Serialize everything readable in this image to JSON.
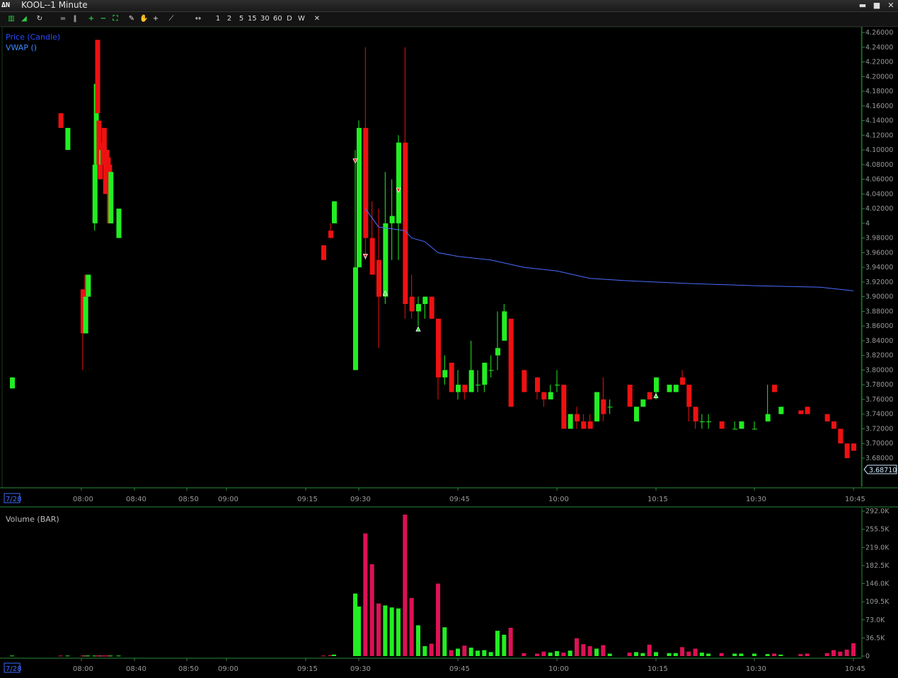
{
  "window": {
    "logo": "ΔΝ",
    "title": "KOOL--1 Minute",
    "controls": {
      "minimize": "▬",
      "maximize": "■",
      "close": "✕"
    }
  },
  "toolbar": {
    "icons": [
      "bar-chart-icon",
      "line-chart-icon",
      "refresh-icon",
      "equals-icon",
      "pause-icon",
      "zoom-in-icon",
      "zoom-out-icon",
      "fit-icon",
      "pencil-icon",
      "hand-icon",
      "crosshair-icon",
      "line-tool-icon",
      "horizontal-scroll-icon"
    ],
    "timeframes": [
      "1",
      "2",
      "5",
      "15",
      "30",
      "60",
      "D",
      "W"
    ],
    "close_label": "✕"
  },
  "price_panel": {
    "legend_price": "Price (Candle)",
    "legend_vwap": "VWAP ()",
    "last_price": "3.68710",
    "axis_ticks": [
      "4.26000",
      "4.24000",
      "4.22000",
      "4.20000",
      "4.18000",
      "4.16000",
      "4.14000",
      "4.12000",
      "4.10000",
      "4.08000",
      "4.06000",
      "4.04000",
      "4.02000",
      "4",
      "3.98000",
      "3.96000",
      "3.94000",
      "3.92000",
      "3.90000",
      "3.88000",
      "3.86000",
      "3.84000",
      "3.82000",
      "3.80000",
      "3.78000",
      "3.76000",
      "3.74000",
      "3.72000",
      "3.70000",
      "3.68000"
    ],
    "date_label": "7/28",
    "time_labels": [
      "08:00",
      "08:40",
      "08:50",
      "09:00",
      "09:15",
      "09:30",
      "09:45",
      "10:00",
      "10:15",
      "10:30",
      "10:45"
    ]
  },
  "volume_panel": {
    "legend": "Volume (BAR)",
    "axis_ticks": [
      "292.0K",
      "255.5K",
      "219.0K",
      "182.5K",
      "146.0K",
      "109.5K",
      "73.0K",
      "36.5K",
      "0"
    ],
    "date_label": "7/28",
    "time_labels": [
      "08:00",
      "08:40",
      "08:50",
      "09:00",
      "09:15",
      "09:30",
      "09:45",
      "10:00",
      "10:15",
      "10:30",
      "10:45"
    ]
  },
  "colors": {
    "up": "#22ee22",
    "down": "#ee1111",
    "vwap": "#4a6cff",
    "volume_up": "#22ee22",
    "volume_down": "#dd1155",
    "grid_green": "#1e6b2a",
    "legend_blue": "#2a4dff"
  },
  "chart_data": {
    "type": "candlestick",
    "symbol": "KOOL",
    "interval": "1 Minute",
    "ylim": [
      3.68,
      4.26
    ],
    "volume_ylim": [
      0,
      292000
    ],
    "candles": [
      {
        "t": "07:40",
        "o": 3.775,
        "h": 3.79,
        "l": 3.775,
        "c": 3.79,
        "v": 1000
      },
      {
        "t": "07:54",
        "o": 4.15,
        "h": 4.15,
        "l": 4.13,
        "c": 4.13,
        "v": 1000
      },
      {
        "t": "07:56",
        "o": 4.1,
        "h": 4.13,
        "l": 4.1,
        "c": 4.13,
        "v": 1000
      },
      {
        "t": "08:01",
        "o": 3.91,
        "h": 3.91,
        "l": 3.8,
        "c": 3.85,
        "v": 1000
      },
      {
        "t": "08:02",
        "o": 3.9,
        "h": 3.9,
        "l": 3.85,
        "c": 3.85,
        "v": 1000
      },
      {
        "t": "08:03",
        "o": 3.85,
        "h": 3.9,
        "l": 3.85,
        "c": 3.9,
        "v": 1000
      },
      {
        "t": "08:04",
        "o": 3.93,
        "h": 3.93,
        "l": 3.9,
        "c": 3.9,
        "v": 1000
      },
      {
        "t": "08:05",
        "o": 3.9,
        "h": 3.93,
        "l": 3.9,
        "c": 3.93,
        "v": 1000
      },
      {
        "t": "08:10",
        "o": 4.0,
        "h": 4.08,
        "l": 3.99,
        "c": 4.08,
        "v": 1000
      },
      {
        "t": "08:11",
        "o": 4.08,
        "h": 4.19,
        "l": 4.08,
        "c": 4.19,
        "v": 1000
      },
      {
        "t": "08:12",
        "o": 4.25,
        "h": 4.25,
        "l": 4.15,
        "c": 4.15,
        "v": 1000
      },
      {
        "t": "08:13",
        "o": 4.14,
        "h": 4.14,
        "l": 4.08,
        "c": 4.08,
        "v": 1000
      },
      {
        "t": "08:14",
        "o": 4.08,
        "h": 4.08,
        "l": 4.06,
        "c": 4.06,
        "v": 1000
      },
      {
        "t": "08:15",
        "o": 4.08,
        "h": 4.1,
        "l": 4.08,
        "c": 4.1,
        "v": 1000
      },
      {
        "t": "08:16",
        "o": 4.11,
        "h": 4.11,
        "l": 4.08,
        "c": 4.08,
        "v": 1000
      },
      {
        "t": "08:17",
        "o": 4.13,
        "h": 4.13,
        "l": 4.08,
        "c": 4.08,
        "v": 1000
      },
      {
        "t": "08:18",
        "o": 4.1,
        "h": 4.1,
        "l": 4.04,
        "c": 4.04,
        "v": 1000
      },
      {
        "t": "08:19",
        "o": 4.1,
        "h": 4.1,
        "l": 4.09,
        "c": 4.09,
        "v": 1000
      },
      {
        "t": "08:20",
        "o": 4.09,
        "h": 4.09,
        "l": 4.08,
        "c": 4.08,
        "v": 1000
      },
      {
        "t": "08:21",
        "o": 4.08,
        "h": 4.08,
        "l": 4.0,
        "c": 4.0,
        "v": 1000
      },
      {
        "t": "08:22",
        "o": 4.0,
        "h": 4.07,
        "l": 4.0,
        "c": 4.07,
        "v": 1000
      },
      {
        "t": "08:28",
        "o": 3.98,
        "h": 4.02,
        "l": 3.98,
        "c": 4.02,
        "v": 1000
      },
      {
        "t": "09:20",
        "o": 3.97,
        "h": 3.97,
        "l": 3.95,
        "c": 3.95,
        "v": 1000
      },
      {
        "t": "09:22",
        "o": 3.99,
        "h": 4.0,
        "l": 3.98,
        "c": 3.98,
        "v": 2000
      },
      {
        "t": "09:23",
        "o": 4.0,
        "h": 4.03,
        "l": 4.0,
        "c": 4.03,
        "v": 3000
      },
      {
        "t": "09:29",
        "o": 3.8,
        "h": 4.1,
        "l": 3.8,
        "c": 3.94,
        "v": 126000
      },
      {
        "t": "09:30",
        "o": 3.94,
        "h": 4.14,
        "l": 3.94,
        "c": 4.13,
        "v": 100000
      },
      {
        "t": "09:31",
        "o": 4.13,
        "h": 4.24,
        "l": 3.95,
        "c": 3.98,
        "v": 247000
      },
      {
        "t": "09:32",
        "o": 3.98,
        "h": 4.03,
        "l": 3.93,
        "c": 3.93,
        "v": 185000
      },
      {
        "t": "09:33",
        "o": 3.95,
        "h": 4.02,
        "l": 3.83,
        "c": 3.9,
        "v": 106000
      },
      {
        "t": "09:34",
        "o": 3.9,
        "h": 4.07,
        "l": 3.89,
        "c": 4.0,
        "v": 102000
      },
      {
        "t": "09:35",
        "o": 4.0,
        "h": 4.06,
        "l": 3.95,
        "c": 4.01,
        "v": 98000
      },
      {
        "t": "09:36",
        "o": 4.0,
        "h": 4.12,
        "l": 3.95,
        "c": 4.11,
        "v": 96000
      },
      {
        "t": "09:37",
        "o": 4.11,
        "h": 4.24,
        "l": 3.87,
        "c": 3.89,
        "v": 285000
      },
      {
        "t": "09:38",
        "o": 3.9,
        "h": 3.93,
        "l": 3.87,
        "c": 3.88,
        "v": 117000
      },
      {
        "t": "09:39",
        "o": 3.88,
        "h": 3.9,
        "l": 3.86,
        "c": 3.89,
        "v": 62000
      },
      {
        "t": "09:40",
        "o": 3.89,
        "h": 3.9,
        "l": 3.87,
        "c": 3.9,
        "v": 20000
      },
      {
        "t": "09:41",
        "o": 3.9,
        "h": 3.9,
        "l": 3.87,
        "c": 3.87,
        "v": 25000
      },
      {
        "t": "09:42",
        "o": 3.87,
        "h": 3.87,
        "l": 3.76,
        "c": 3.79,
        "v": 146000
      },
      {
        "t": "09:43",
        "o": 3.79,
        "h": 3.82,
        "l": 3.78,
        "c": 3.8,
        "v": 58000
      },
      {
        "t": "09:44",
        "o": 3.81,
        "h": 3.81,
        "l": 3.77,
        "c": 3.77,
        "v": 12000
      },
      {
        "t": "09:45",
        "o": 3.77,
        "h": 3.8,
        "l": 3.76,
        "c": 3.78,
        "v": 15000
      },
      {
        "t": "09:46",
        "o": 3.78,
        "h": 3.78,
        "l": 3.76,
        "c": 3.77,
        "v": 21000
      },
      {
        "t": "09:47",
        "o": 3.77,
        "h": 3.84,
        "l": 3.77,
        "c": 3.8,
        "v": 17000
      },
      {
        "t": "09:48",
        "o": 3.78,
        "h": 3.8,
        "l": 3.77,
        "c": 3.78,
        "v": 11000
      },
      {
        "t": "09:49",
        "o": 3.78,
        "h": 3.81,
        "l": 3.77,
        "c": 3.81,
        "v": 12000
      },
      {
        "t": "09:50",
        "o": 3.8,
        "h": 3.82,
        "l": 3.79,
        "c": 3.8,
        "v": 8000
      },
      {
        "t": "09:51",
        "o": 3.82,
        "h": 3.88,
        "l": 3.8,
        "c": 3.83,
        "v": 51000
      },
      {
        "t": "09:52",
        "o": 3.84,
        "h": 3.89,
        "l": 3.84,
        "c": 3.88,
        "v": 43000
      },
      {
        "t": "09:53",
        "o": 3.87,
        "h": 3.87,
        "l": 3.75,
        "c": 3.75,
        "v": 57000
      },
      {
        "t": "09:55",
        "o": 3.8,
        "h": 3.8,
        "l": 3.77,
        "c": 3.77,
        "v": 6000
      },
      {
        "t": "09:57",
        "o": 3.79,
        "h": 3.79,
        "l": 3.76,
        "c": 3.77,
        "v": 5000
      },
      {
        "t": "09:58",
        "o": 3.77,
        "h": 3.77,
        "l": 3.75,
        "c": 3.76,
        "v": 9000
      },
      {
        "t": "09:59",
        "o": 3.76,
        "h": 3.78,
        "l": 3.76,
        "c": 3.77,
        "v": 7000
      },
      {
        "t": "10:00",
        "o": 3.78,
        "h": 3.8,
        "l": 3.77,
        "c": 3.78,
        "v": 10000
      },
      {
        "t": "10:01",
        "o": 3.78,
        "h": 3.78,
        "l": 3.72,
        "c": 3.72,
        "v": 7000
      },
      {
        "t": "10:02",
        "o": 3.72,
        "h": 3.74,
        "l": 3.72,
        "c": 3.74,
        "v": 11000
      },
      {
        "t": "10:03",
        "o": 3.74,
        "h": 3.75,
        "l": 3.72,
        "c": 3.73,
        "v": 36000
      },
      {
        "t": "10:04",
        "o": 3.73,
        "h": 3.74,
        "l": 3.72,
        "c": 3.72,
        "v": 24000
      },
      {
        "t": "10:05",
        "o": 3.73,
        "h": 3.74,
        "l": 3.72,
        "c": 3.72,
        "v": 20000
      },
      {
        "t": "10:06",
        "o": 3.73,
        "h": 3.77,
        "l": 3.73,
        "c": 3.77,
        "v": 15000
      },
      {
        "t": "10:07",
        "o": 3.76,
        "h": 3.79,
        "l": 3.73,
        "c": 3.74,
        "v": 22000
      },
      {
        "t": "10:08",
        "o": 3.75,
        "h": 3.76,
        "l": 3.74,
        "c": 3.75,
        "v": 5000
      },
      {
        "t": "10:11",
        "o": 3.78,
        "h": 3.78,
        "l": 3.75,
        "c": 3.75,
        "v": 7000
      },
      {
        "t": "10:12",
        "o": 3.73,
        "h": 3.75,
        "l": 3.73,
        "c": 3.75,
        "v": 8000
      },
      {
        "t": "10:13",
        "o": 3.75,
        "h": 3.76,
        "l": 3.75,
        "c": 3.76,
        "v": 6000
      },
      {
        "t": "10:14",
        "o": 3.77,
        "h": 3.77,
        "l": 3.76,
        "c": 3.76,
        "v": 23000
      },
      {
        "t": "10:15",
        "o": 3.77,
        "h": 3.79,
        "l": 3.76,
        "c": 3.79,
        "v": 8000
      },
      {
        "t": "10:17",
        "o": 3.77,
        "h": 3.78,
        "l": 3.77,
        "c": 3.78,
        "v": 6000
      },
      {
        "t": "10:18",
        "o": 3.77,
        "h": 3.78,
        "l": 3.77,
        "c": 3.78,
        "v": 6000
      },
      {
        "t": "10:19",
        "o": 3.79,
        "h": 3.8,
        "l": 3.78,
        "c": 3.78,
        "v": 18000
      },
      {
        "t": "10:20",
        "o": 3.78,
        "h": 3.78,
        "l": 3.73,
        "c": 3.75,
        "v": 9000
      },
      {
        "t": "10:21",
        "o": 3.75,
        "h": 3.75,
        "l": 3.72,
        "c": 3.73,
        "v": 15000
      },
      {
        "t": "10:22",
        "o": 3.73,
        "h": 3.74,
        "l": 3.72,
        "c": 3.73,
        "v": 7000
      },
      {
        "t": "10:23",
        "o": 3.73,
        "h": 3.74,
        "l": 3.72,
        "c": 3.73,
        "v": 5000
      },
      {
        "t": "10:25",
        "o": 3.73,
        "h": 3.73,
        "l": 3.72,
        "c": 3.72,
        "v": 6000
      },
      {
        "t": "10:27",
        "o": 3.72,
        "h": 3.73,
        "l": 3.72,
        "c": 3.72,
        "v": 5000
      },
      {
        "t": "10:28",
        "o": 3.72,
        "h": 3.73,
        "l": 3.72,
        "c": 3.73,
        "v": 5000
      },
      {
        "t": "10:30",
        "o": 3.72,
        "h": 3.73,
        "l": 3.72,
        "c": 3.72,
        "v": 5000
      },
      {
        "t": "10:32",
        "o": 3.73,
        "h": 3.78,
        "l": 3.73,
        "c": 3.74,
        "v": 4000
      },
      {
        "t": "10:33",
        "o": 3.78,
        "h": 3.78,
        "l": 3.77,
        "c": 3.77,
        "v": 5000
      },
      {
        "t": "10:34",
        "o": 3.74,
        "h": 3.75,
        "l": 3.74,
        "c": 3.75,
        "v": 3000
      },
      {
        "t": "10:37",
        "o": 3.745,
        "h": 3.745,
        "l": 3.74,
        "c": 3.74,
        "v": 4000
      },
      {
        "t": "10:38",
        "o": 3.75,
        "h": 3.75,
        "l": 3.74,
        "c": 3.74,
        "v": 5000
      },
      {
        "t": "10:41",
        "o": 3.74,
        "h": 3.74,
        "l": 3.73,
        "c": 3.73,
        "v": 6000
      },
      {
        "t": "10:42",
        "o": 3.73,
        "h": 3.73,
        "l": 3.72,
        "c": 3.72,
        "v": 12000
      },
      {
        "t": "10:43",
        "o": 3.72,
        "h": 3.72,
        "l": 3.7,
        "c": 3.7,
        "v": 9000
      },
      {
        "t": "10:44",
        "o": 3.7,
        "h": 3.7,
        "l": 3.68,
        "c": 3.68,
        "v": 13000
      },
      {
        "t": "10:45",
        "o": 3.7,
        "h": 3.7,
        "l": 3.69,
        "c": 3.69,
        "v": 26000
      }
    ],
    "vwap": [
      {
        "t": "09:31",
        "v": 4.02
      },
      {
        "t": "09:33",
        "v": 3.995
      },
      {
        "t": "09:37",
        "v": 3.99
      },
      {
        "t": "09:38",
        "v": 3.98
      },
      {
        "t": "09:40",
        "v": 3.975
      },
      {
        "t": "09:42",
        "v": 3.96
      },
      {
        "t": "09:45",
        "v": 3.955
      },
      {
        "t": "09:50",
        "v": 3.95
      },
      {
        "t": "09:55",
        "v": 3.94
      },
      {
        "t": "10:00",
        "v": 3.935
      },
      {
        "t": "10:05",
        "v": 3.925
      },
      {
        "t": "10:10",
        "v": 3.922
      },
      {
        "t": "10:20",
        "v": 3.918
      },
      {
        "t": "10:30",
        "v": 3.915
      },
      {
        "t": "10:40",
        "v": 3.913
      },
      {
        "t": "10:45",
        "v": 3.908
      }
    ],
    "markers": [
      {
        "t": "09:29",
        "price": 4.085,
        "kind": "sell"
      },
      {
        "t": "09:31",
        "price": 3.955,
        "kind": "sell"
      },
      {
        "t": "09:34",
        "price": 3.905,
        "kind": "buy"
      },
      {
        "t": "09:36",
        "price": 4.045,
        "kind": "sell"
      },
      {
        "t": "09:39",
        "price": 3.856,
        "kind": "buy"
      },
      {
        "t": "10:15",
        "price": 3.765,
        "kind": "buy"
      }
    ]
  }
}
